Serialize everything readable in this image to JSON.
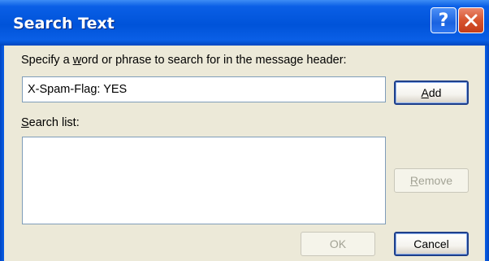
{
  "window": {
    "title": "Search Text",
    "help_symbol": "?",
    "close_symbol": "✕"
  },
  "dialog": {
    "prompt_label": "Specify a word or phrase to search for in the message header:",
    "prompt_label_parts": [
      "Specify a ",
      "w",
      "ord or phrase to search for in the message header:"
    ],
    "search_value": "X-Spam-Flag: YES",
    "list_label_parts": [
      "S",
      "earch list:"
    ],
    "search_list_items": []
  },
  "buttons": {
    "add_parts": [
      "A",
      "dd"
    ],
    "remove_parts": [
      "R",
      "emove"
    ],
    "ok": "OK",
    "cancel": "Cancel"
  },
  "colors": {
    "titlebar": "#0a5fe6",
    "client_background": "#ece9d8",
    "close_button": "#d7542e"
  }
}
